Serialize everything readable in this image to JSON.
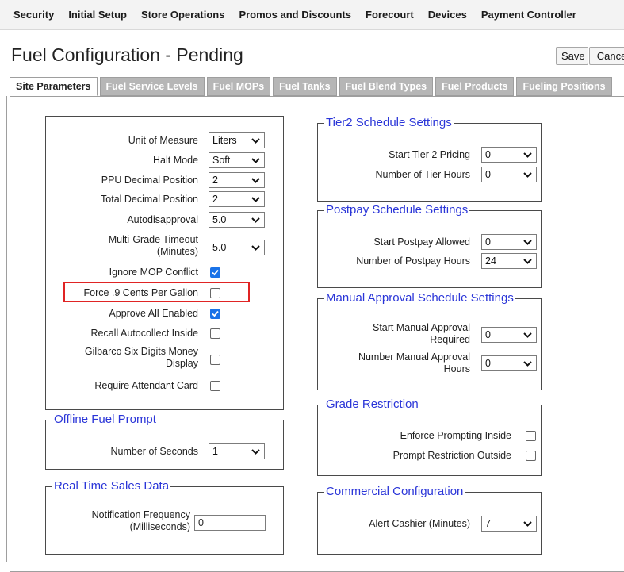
{
  "nav": {
    "items": [
      "Security",
      "Initial Setup",
      "Store Operations",
      "Promos and Discounts",
      "Forecourt",
      "Devices",
      "Payment Controller"
    ]
  },
  "page": {
    "title": "Fuel Configuration - Pending",
    "save_label": "Save",
    "cancel_label": "Cancel"
  },
  "tabs": [
    "Site Parameters",
    "Fuel Service Levels",
    "Fuel MOPs",
    "Fuel Tanks",
    "Fuel Blend Types",
    "Fuel Products",
    "Fueling Positions"
  ],
  "active_tab": "Site Parameters",
  "site": {
    "unit_of_measure": {
      "label": "Unit of Measure",
      "value": "Liters"
    },
    "halt_mode": {
      "label": "Halt Mode",
      "value": "Soft"
    },
    "ppu_decimal": {
      "label": "PPU Decimal Position",
      "value": "2"
    },
    "total_decimal": {
      "label": "Total Decimal Position",
      "value": "2"
    },
    "autodisapproval": {
      "label": "Autodisapproval",
      "value": "5.0"
    },
    "multi_grade": {
      "label_line1": "Multi-Grade Timeout",
      "label_line2": "(Minutes)",
      "value": "5.0"
    },
    "ignore_mop": {
      "label": "Ignore MOP Conflict",
      "checked": true
    },
    "force_9": {
      "label": "Force .9 Cents Per Gallon",
      "checked": false
    },
    "approve_all": {
      "label": "Approve All Enabled",
      "checked": true
    },
    "recall_auto": {
      "label": "Recall Autocollect Inside",
      "checked": false
    },
    "gilbarco": {
      "label_line1": "Gilbarco Six Digits Money",
      "label_line2": "Display",
      "checked": false
    },
    "require_att": {
      "label": "Require Attendant Card",
      "checked": false
    }
  },
  "offline": {
    "legend": "Offline Fuel Prompt",
    "seconds_label": "Number of Seconds",
    "seconds_value": "1"
  },
  "realtime": {
    "legend": "Real Time Sales Data",
    "freq_label_line1": "Notification Frequency",
    "freq_label_line2": "(Milliseconds)",
    "freq_value": "0"
  },
  "tier2": {
    "legend": "Tier2 Schedule Settings",
    "start_label": "Start Tier 2 Pricing",
    "start_value": "0",
    "hours_label": "Number of Tier Hours",
    "hours_value": "0"
  },
  "postpay": {
    "legend": "Postpay Schedule Settings",
    "start_label": "Start Postpay Allowed",
    "start_value": "0",
    "hours_label": "Number of Postpay Hours",
    "hours_value": "24"
  },
  "manual": {
    "legend": "Manual Approval Schedule Settings",
    "start_label_line1": "Start Manual Approval",
    "start_label_line2": "Required",
    "start_value": "0",
    "number_label_line1": "Number Manual Approval",
    "number_label_line2": "Hours",
    "number_value": "0"
  },
  "grade": {
    "legend": "Grade Restriction",
    "enforce_label": "Enforce Prompting Inside",
    "enforce_checked": false,
    "prompt_label": "Prompt Restriction Outside",
    "prompt_checked": false
  },
  "commercial": {
    "legend": "Commercial Configuration",
    "alert_label": "Alert Cashier (Minutes)",
    "alert_value": "7"
  },
  "colors": {
    "legend": "#2a35d8",
    "checkbox": "#1a73e8",
    "highlight": "#e02424"
  }
}
